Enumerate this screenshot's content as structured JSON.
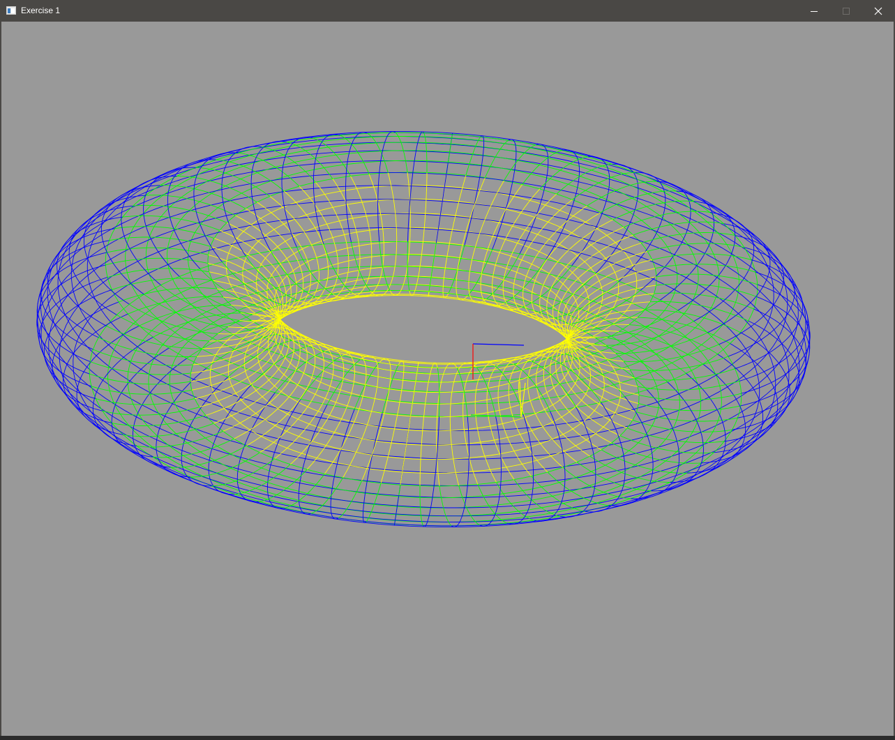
{
  "window": {
    "title": "Exercise 1",
    "controls": [
      "minimize",
      "maximize",
      "close"
    ]
  },
  "scene": {
    "background": "#999999",
    "wire_colors": {
      "outer": "#0000ff",
      "middle": "#00ff00",
      "inner": "#ffff00"
    },
    "axis_colors": {
      "x": "#0000ff",
      "y": "#ff0000",
      "z": "#ffff00",
      "w": "#00ff00"
    },
    "icons": [
      "app-window-icon",
      "minimize-icon",
      "maximize-icon",
      "close-icon"
    ]
  }
}
